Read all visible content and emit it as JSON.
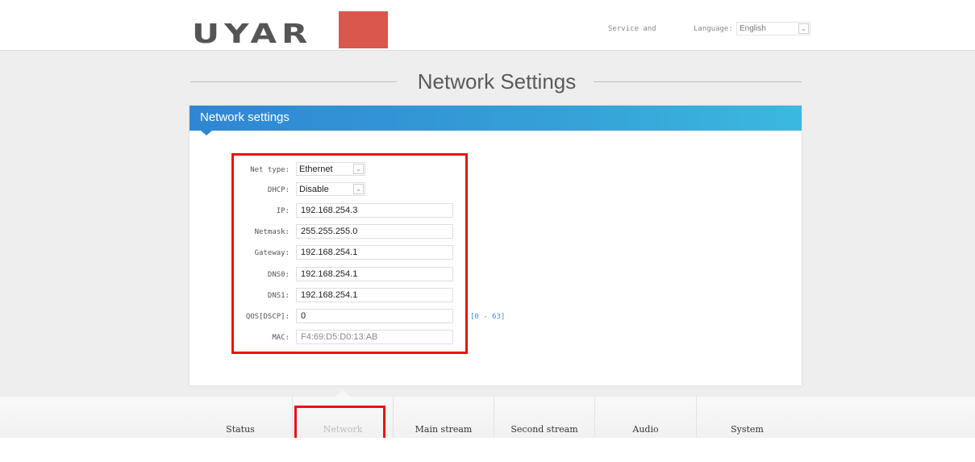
{
  "header": {
    "logo_text": "UYAR",
    "service_link": "Service and",
    "language_label": "Language:",
    "language_value": "English"
  },
  "page": {
    "title": "Network Settings"
  },
  "panel": {
    "title": "Network settings",
    "fields": [
      {
        "label": "Net type:",
        "type": "select",
        "value": "Ethernet"
      },
      {
        "label": "DHCP:",
        "type": "select",
        "value": "Disable"
      },
      {
        "label": "IP:",
        "type": "input",
        "value": "192.168.254.3"
      },
      {
        "label": "Netmask:",
        "type": "input",
        "value": "255.255.255.0"
      },
      {
        "label": "Gateway:",
        "type": "input",
        "value": "192.168.254.1"
      },
      {
        "label": "DNS0:",
        "type": "input",
        "value": "192.168.254.1"
      },
      {
        "label": "DNS1:",
        "type": "input",
        "value": "192.168.254.1"
      },
      {
        "label": "QOS[DSCP]:",
        "type": "input",
        "value": "0",
        "hint": "[0 - 63]"
      },
      {
        "label": "MAC:",
        "type": "input",
        "value": "F4:69:D5:D0:13:AB",
        "readonly": true
      }
    ]
  },
  "nav": {
    "items": [
      {
        "label": "Status"
      },
      {
        "label": "Network",
        "active": true
      },
      {
        "label": "Main stream"
      },
      {
        "label": "Second stream"
      },
      {
        "label": "Audio"
      },
      {
        "label": "System"
      }
    ]
  },
  "colors": {
    "accent": "#2f86d3",
    "highlight": "#ee1111",
    "logo_red": "#d9574c"
  },
  "icons": {
    "select_arrow": "chevron-down-icon"
  }
}
